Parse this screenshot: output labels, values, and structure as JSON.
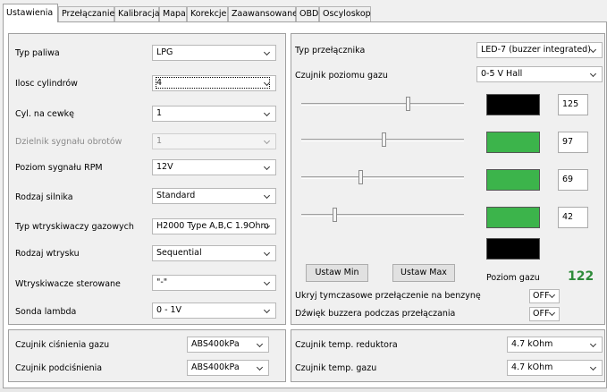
{
  "tabs": [
    {
      "label": "Ustawienia",
      "active": true
    },
    {
      "label": "Przełączanie",
      "active": false
    },
    {
      "label": "Kalibracja",
      "active": false
    },
    {
      "label": "Mapa",
      "active": false
    },
    {
      "label": "Korekcje",
      "active": false
    },
    {
      "label": "Zaawansowane",
      "active": false
    },
    {
      "label": "OBD",
      "active": false
    },
    {
      "label": "Oscyloskop",
      "active": false
    }
  ],
  "left_settings": [
    {
      "label": "Typ paliwa",
      "value": "LPG"
    },
    {
      "label": "Ilosc cylindrów",
      "value": "4"
    },
    {
      "label": "Cyl. na cewkę",
      "value": "1"
    },
    {
      "label": "Dzielnik sygnału obrotów",
      "value": "1",
      "disabled": true
    },
    {
      "label": "Poziom sygnału RPM",
      "value": "12V"
    },
    {
      "label": "Rodzaj silnika",
      "value": "Standard"
    },
    {
      "label": "Typ wtryskiwaczy gazowych",
      "value": "H2000 Type A,B,C 1.9Ohm"
    },
    {
      "label": "Rodzaj wtrysku",
      "value": "Sequential"
    },
    {
      "label": "Wtryskiwacze sterowane",
      "value": "\"-\""
    },
    {
      "label": "Sonda lambda",
      "value": "0 - 1V"
    }
  ],
  "switch_type": {
    "label": "Typ przełącznika",
    "value": "LED-7 (buzzer integrated)"
  },
  "gas_level_sensor": {
    "label": "Czujnik poziomu gazu",
    "value": "0-5 V Hall"
  },
  "level_rows": [
    {
      "value": "125",
      "color": "#000000",
      "slider_fraction": 0.66
    },
    {
      "value": "97",
      "color": "#3cb44b",
      "slider_fraction": 0.51
    },
    {
      "value": "69",
      "color": "#3cb44b",
      "slider_fraction": 0.37
    },
    {
      "value": "42",
      "color": "#3cb44b",
      "slider_fraction": 0.21
    },
    {
      "value": "",
      "color": "#000000"
    }
  ],
  "buttons": {
    "set_min": "Ustaw Min",
    "set_max": "Ustaw Max"
  },
  "gas_level": {
    "label": "Poziom gazu",
    "value": "122"
  },
  "temp_switch_option": {
    "label": "Ukryj tymczasowe przełączenie na benzynę",
    "value": "OFF"
  },
  "buzzer_option": {
    "label": "Dźwięk buzzera podczas przełączania",
    "value": "OFF"
  },
  "pressure_sensors": [
    {
      "label": "Czujnik ciśnienia gazu",
      "value": "ABS400kPa"
    },
    {
      "label": "Czujnik podciśnienia",
      "value": "ABS400kPa"
    }
  ],
  "temp_sensors": [
    {
      "label": "Czujnik temp. reduktora",
      "value": "4.7 kOhm"
    },
    {
      "label": "Czujnik temp. gazu",
      "value": "4.7 kOhm"
    }
  ],
  "colors": {
    "green": "#3cb44b",
    "black": "#000000",
    "gas_value_text": "#2e8b3a"
  }
}
